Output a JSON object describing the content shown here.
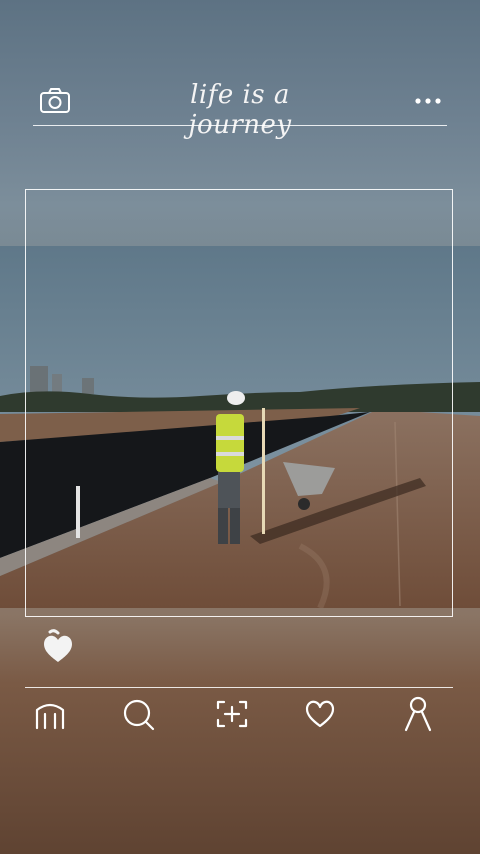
{
  "header": {
    "title": "life is a journey",
    "camera_icon": "camera-icon",
    "more_icon": "more-dots-icon"
  },
  "photo": {
    "description_icon": "photo"
  },
  "post": {
    "like_icon": "heart-filled-icon"
  },
  "nav": {
    "items": [
      {
        "name": "home",
        "icon": "home-icon"
      },
      {
        "name": "search",
        "icon": "search-icon"
      },
      {
        "name": "scan",
        "icon": "scan-add-icon"
      },
      {
        "name": "favorites",
        "icon": "heart-outline-icon"
      },
      {
        "name": "profile",
        "icon": "person-icon"
      }
    ]
  },
  "colors": {
    "sky": "#6e8191",
    "ground": "#7a5a45",
    "stroke": "#ffffff"
  }
}
